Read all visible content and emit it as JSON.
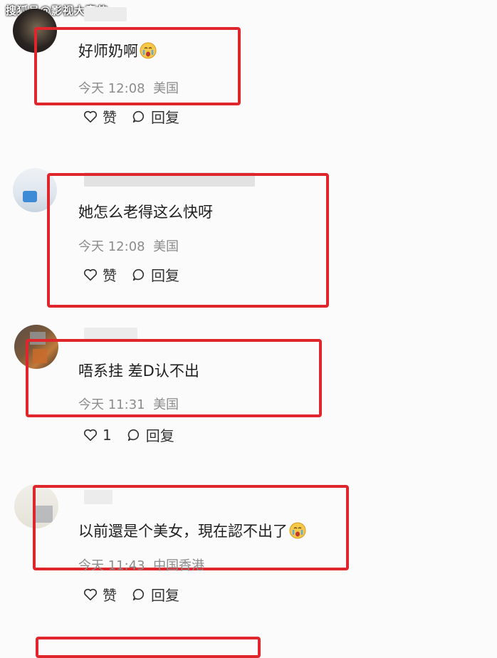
{
  "watermark": "搜狐号@影视大豪侠",
  "comments": [
    {
      "text": "好师奶啊",
      "time": "今天 12:08",
      "location": "美国",
      "like_label": "赞",
      "reply_label": "回复",
      "emoji": "crying-face"
    },
    {
      "text": "她怎么老得这么快呀",
      "time": "今天 12:08",
      "location": "美国",
      "like_label": "赞",
      "reply_label": "回复"
    },
    {
      "text": "唔系挂 差D认不出",
      "time": "今天 11:31",
      "location": "美国",
      "like_label": "1",
      "reply_label": "回复"
    },
    {
      "text": "以前還是个美女，現在認不出了",
      "time": "今天 11:43",
      "location": "中国香港",
      "like_label": "赞",
      "reply_label": "回复",
      "emoji": "crying-face"
    }
  ],
  "colors": {
    "highlight": "#e0262d",
    "meta_text": "#8c8c8c",
    "background": "#fbfbfb"
  }
}
